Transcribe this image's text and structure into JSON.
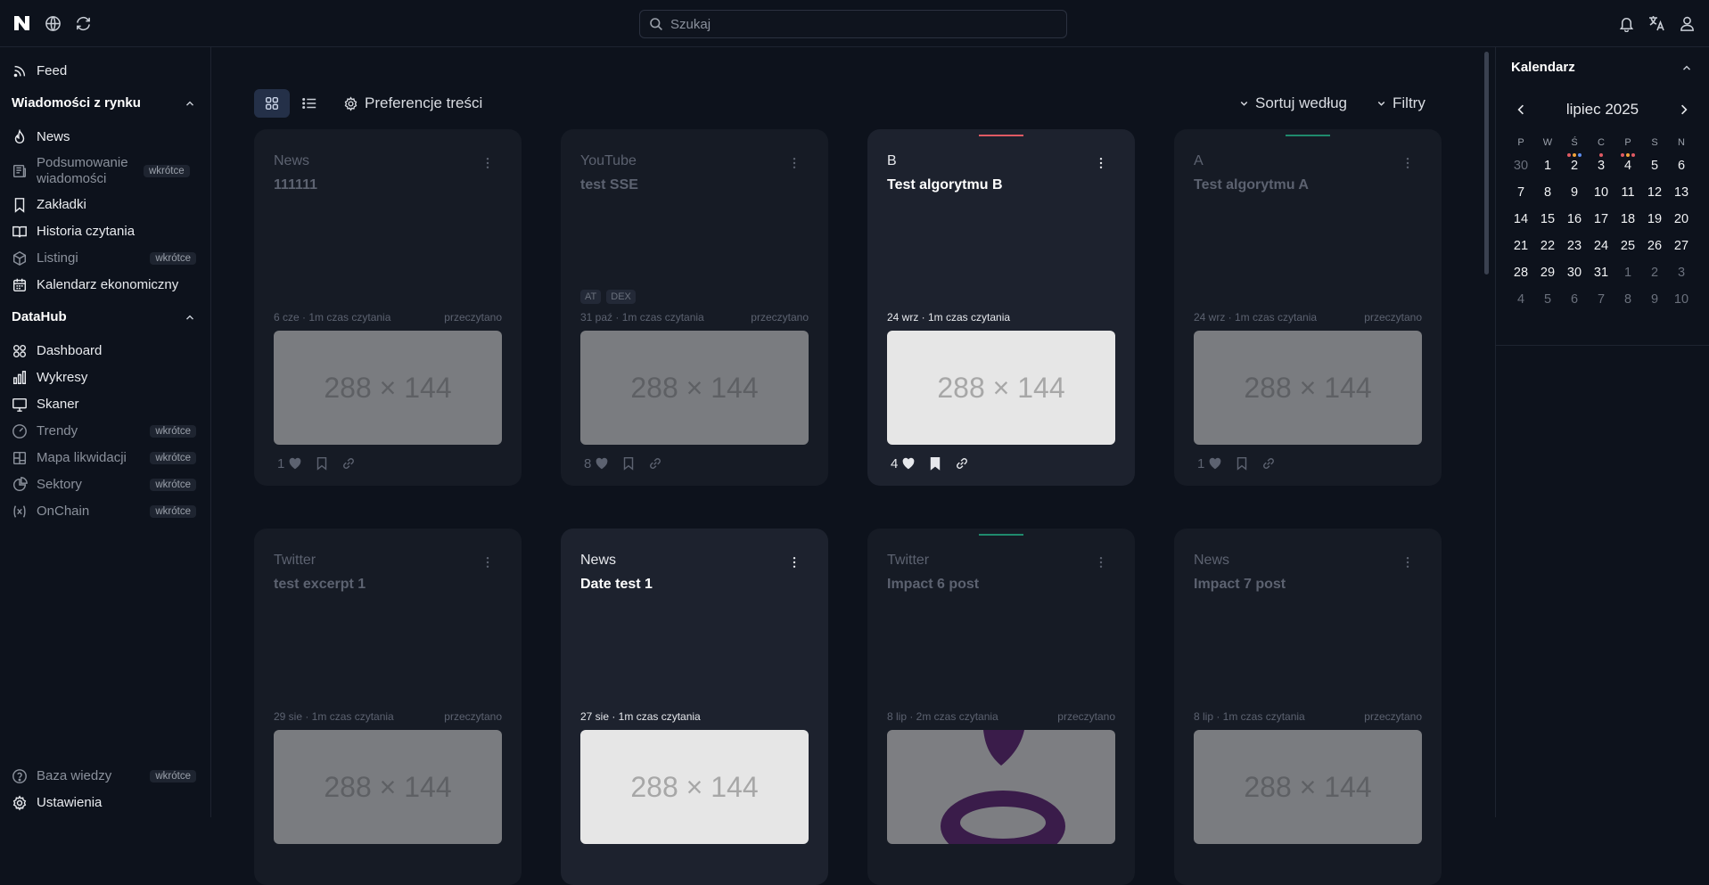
{
  "search": {
    "placeholder": "Szukaj"
  },
  "sidebar": {
    "feed": "Feed",
    "market_section": "Wiadomości z rynku",
    "market_items": [
      {
        "label": "News",
        "icon": "flame-icon",
        "badge": ""
      },
      {
        "label": "Podsumowanie wiadomości",
        "icon": "newspaper-icon",
        "badge": "wkrótce"
      },
      {
        "label": "Zakładki",
        "icon": "bookmark-icon",
        "badge": ""
      },
      {
        "label": "Historia czytania",
        "icon": "book-open-icon",
        "badge": ""
      },
      {
        "label": "Listingi",
        "icon": "box-icon",
        "badge": "wkrótce"
      },
      {
        "label": "Kalendarz ekonomiczny",
        "icon": "calendar-icon",
        "badge": ""
      }
    ],
    "datahub_section": "DataHub",
    "datahub_items": [
      {
        "label": "Dashboard",
        "icon": "grid-icon",
        "badge": ""
      },
      {
        "label": "Wykresy",
        "icon": "bar-chart-icon",
        "badge": ""
      },
      {
        "label": "Skaner",
        "icon": "monitor-icon",
        "badge": ""
      },
      {
        "label": "Trendy",
        "icon": "gauge-icon",
        "badge": "wkrótce"
      },
      {
        "label": "Mapa likwidacji",
        "icon": "map-grid-icon",
        "badge": "wkrótce"
      },
      {
        "label": "Sektory",
        "icon": "pie-chart-icon",
        "badge": "wkrótce"
      },
      {
        "label": "OnChain",
        "icon": "variable-icon",
        "badge": "wkrótce"
      }
    ],
    "bottom_items": [
      {
        "label": "Baza wiedzy",
        "icon": "help-circle-icon",
        "badge": "wkrótce"
      },
      {
        "label": "Ustawienia",
        "icon": "gear-icon",
        "badge": ""
      }
    ]
  },
  "toolbar": {
    "preferences": "Preferencje treści",
    "sort": "Sortuj według",
    "filters": "Filtry"
  },
  "cards": [
    {
      "source": "News",
      "title": "111111",
      "tags": [],
      "date": "6 cze · 1m czas czytania",
      "status": "przeczytano",
      "thumb": "288 × 144",
      "likes": "1",
      "active": false,
      "accent": ""
    },
    {
      "source": "YouTube",
      "title": "test SSE",
      "tags": [
        "AT",
        "DEX"
      ],
      "date": "31 paź · 1m czas czytania",
      "status": "przeczytano",
      "thumb": "288 × 144",
      "likes": "8",
      "active": false,
      "accent": ""
    },
    {
      "source": "B",
      "title": "Test algorytmu B",
      "tags": [],
      "date": "24 wrz · 1m czas czytania",
      "status": "",
      "thumb": "288 × 144",
      "likes": "4",
      "active": true,
      "accent": "#e05a63"
    },
    {
      "source": "A",
      "title": "Test algorytmu A",
      "tags": [],
      "date": "24 wrz · 1m czas czytania",
      "status": "przeczytano",
      "thumb": "288 × 144",
      "likes": "1",
      "active": false,
      "accent": "#1f8a6d"
    },
    {
      "source": "Twitter",
      "title": "test excerpt 1",
      "tags": [],
      "date": "29 sie · 1m czas czytania",
      "status": "przeczytano",
      "thumb": "288 × 144",
      "likes": "",
      "active": false,
      "accent": ""
    },
    {
      "source": "News",
      "title": "Date test 1",
      "tags": [],
      "date": "27 sie · 1m czas czytania",
      "status": "",
      "thumb": "288 × 144",
      "likes": "",
      "active": true,
      "accent": ""
    },
    {
      "source": "Twitter",
      "title": "Impact 6 post",
      "tags": [],
      "date": "8 lip · 2m czas czytania",
      "status": "przeczytano",
      "thumb": "",
      "likes": "",
      "active": false,
      "accent": "#1f8a6d"
    },
    {
      "source": "News",
      "title": "Impact 7 post",
      "tags": [],
      "date": "8 lip · 1m czas czytania",
      "status": "przeczytano",
      "thumb": "288 × 144",
      "likes": "",
      "active": false,
      "accent": ""
    }
  ],
  "calendar": {
    "title": "Kalendarz",
    "month": "lipiec 2025",
    "weekdays": [
      "P",
      "W",
      "Ś",
      "C",
      "P",
      "S",
      "N"
    ],
    "weeks": [
      [
        "30",
        "1",
        "2",
        "3",
        "4",
        "5",
        "6"
      ],
      [
        "7",
        "8",
        "9",
        "10",
        "11",
        "12",
        "13"
      ],
      [
        "14",
        "15",
        "16",
        "17",
        "18",
        "19",
        "20"
      ],
      [
        "21",
        "22",
        "23",
        "24",
        "25",
        "26",
        "27"
      ],
      [
        "28",
        "29",
        "30",
        "31",
        "1",
        "2",
        "3"
      ],
      [
        "4",
        "5",
        "6",
        "7",
        "8",
        "9",
        "10"
      ]
    ],
    "event_dots": {
      "2": [
        "#e05a63",
        "#f0a33a",
        "#5b8def"
      ],
      "3": [
        "#e05a63"
      ],
      "4": [
        "#e05a63",
        "#f0a33a",
        "#e05a63"
      ]
    }
  },
  "colors": {
    "accent_red": "#e05a63",
    "accent_green": "#1f8a6d",
    "background": "#0d121c"
  }
}
